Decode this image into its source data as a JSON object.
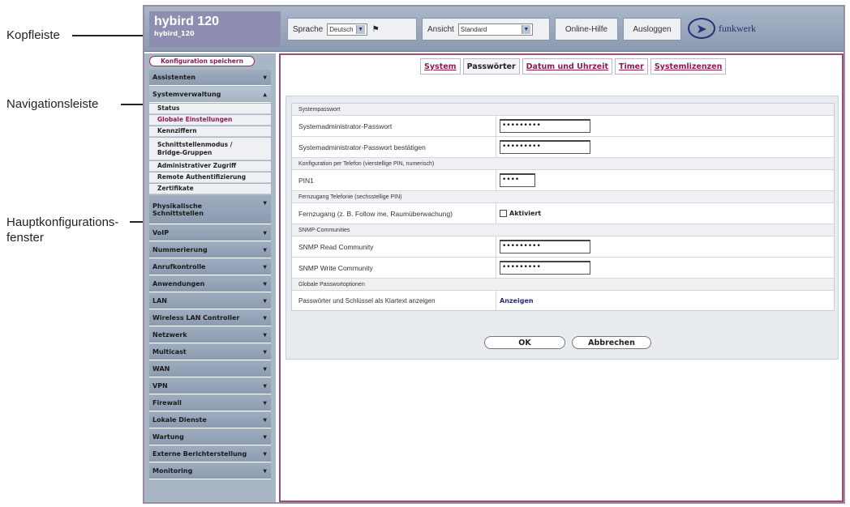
{
  "annotations": {
    "header": "Kopfleiste",
    "navigation": "Navigationsleiste",
    "main_line1": "Hauptkonfigurations-",
    "main_line2": "fenster"
  },
  "header": {
    "product": "hybird 120",
    "model": "hybird_120",
    "language_label": "Sprache",
    "language_value": "Deutsch",
    "view_label": "Ansicht",
    "view_value": "Standard",
    "help": "Online-Hilfe",
    "logout": "Ausloggen",
    "logo_text": "funkwerk"
  },
  "sidebar": {
    "save": "Konfiguration speichern",
    "items": [
      {
        "label": "Assistenten"
      },
      {
        "label": "Systemverwaltung"
      },
      {
        "label": "Physikalische"
      },
      {
        "label": "Schnittstellen"
      },
      {
        "label": "VoIP"
      },
      {
        "label": "Nummerierung"
      },
      {
        "label": "Anrufkontrolle"
      },
      {
        "label": "Anwendungen"
      },
      {
        "label": "LAN"
      },
      {
        "label": "Wireless LAN Controller"
      },
      {
        "label": "Netzwerk"
      },
      {
        "label": "Multicast"
      },
      {
        "label": "WAN"
      },
      {
        "label": "VPN"
      },
      {
        "label": "Firewall"
      },
      {
        "label": "Lokale Dienste"
      },
      {
        "label": "Wartung"
      },
      {
        "label": "Externe Berichterstellung"
      },
      {
        "label": "Monitoring"
      }
    ],
    "subitems": [
      {
        "label": "Status"
      },
      {
        "label": "Globale Einstellungen"
      },
      {
        "label": "Kennziffern"
      },
      {
        "label": "Schnittstellenmodus /"
      },
      {
        "label": "Bridge-Gruppen"
      },
      {
        "label": "Administrativer Zugriff"
      },
      {
        "label": "Remote Authentifizierung"
      },
      {
        "label": "Zertifikate"
      }
    ]
  },
  "tabs": [
    "System",
    "Passwörter",
    "Datum und Uhrzeit",
    "Timer",
    "Systemlizenzen"
  ],
  "form": {
    "sections": [
      {
        "title": "Systempasswort"
      },
      {
        "title": "Konfiguration per Telefon (vierstellige PIN, numerisch)"
      },
      {
        "title": "Fernzugang Telefonie (sechsstellige PIN)"
      },
      {
        "title": "SNMP-Communities"
      },
      {
        "title": "Globale Passwortoptionen"
      }
    ],
    "rows": [
      {
        "label": "Systemadministrator-Passwort",
        "value": "•••••••••"
      },
      {
        "label": "Systemadministrator-Passwort bestätigen",
        "value": "•••••••••"
      },
      {
        "label": "PIN1",
        "value": "••••"
      },
      {
        "label": "Fernzugang (z. B. Follow me, Raumüberwachung)",
        "value": "Aktiviert"
      },
      {
        "label": "SNMP Read Community",
        "value": "•••••••••"
      },
      {
        "label": "SNMP Write Community",
        "value": "•••••••••"
      },
      {
        "label": "Passwörter und Schlüssel als Klartext anzeigen",
        "value": "Anzeigen"
      }
    ]
  },
  "buttons": {
    "ok": "OK",
    "cancel": "Abbrechen"
  }
}
